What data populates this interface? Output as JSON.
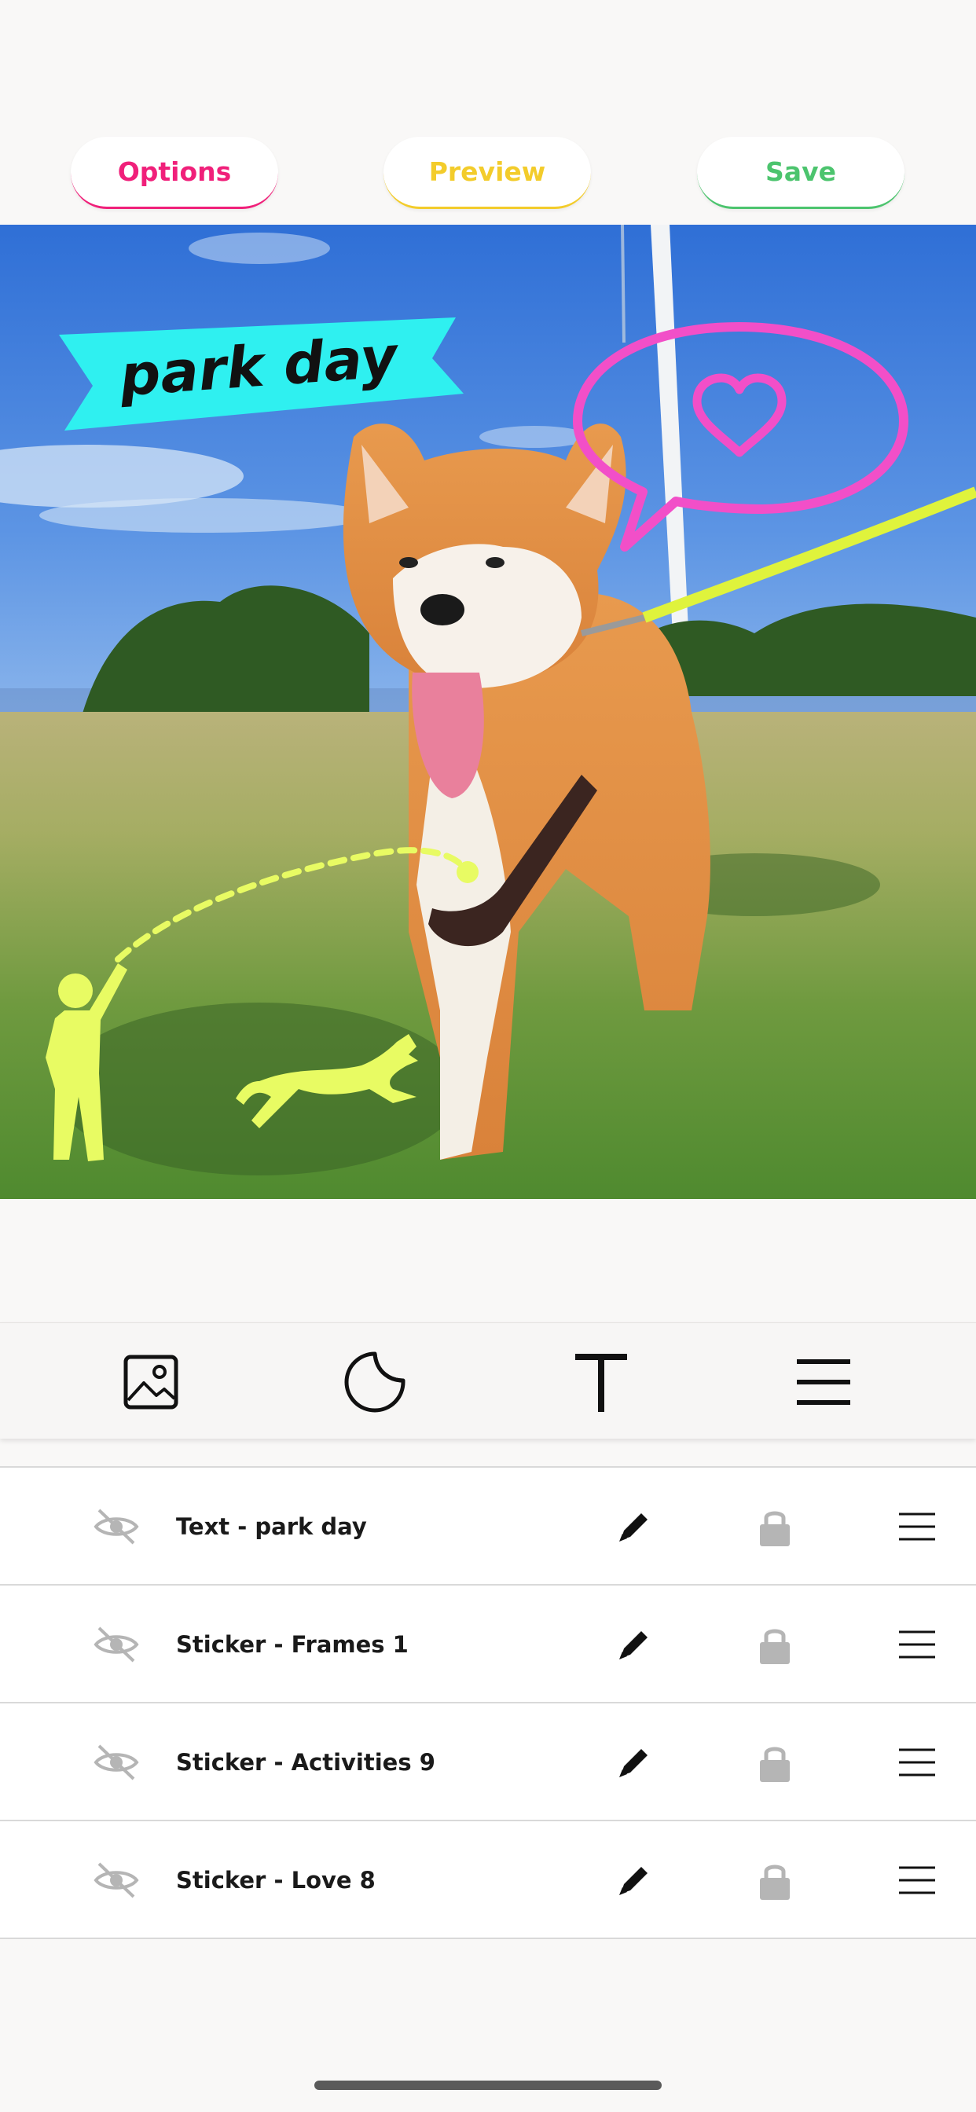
{
  "header": {
    "options_label": "Options",
    "preview_label": "Preview",
    "save_label": "Save",
    "colors": {
      "options": "#f0207a",
      "preview": "#f3cc2b",
      "save": "#4cc46e"
    }
  },
  "canvas": {
    "text_sticker": "park day",
    "stickers": [
      "banner",
      "speech-bubble-heart",
      "person-throwing",
      "running-dog",
      "dashed-arc"
    ],
    "sticker_colors": {
      "banner": "#2ff0f0",
      "bubble": "#f24fc8",
      "lime": "#e8fb63"
    }
  },
  "toolbar": {
    "items": [
      {
        "icon": "image-icon"
      },
      {
        "icon": "sticker-icon"
      },
      {
        "icon": "text-icon"
      },
      {
        "icon": "layers-menu-icon"
      }
    ]
  },
  "layers": {
    "items": [
      {
        "label": "Text - park day"
      },
      {
        "label": "Sticker - Frames 1"
      },
      {
        "label": "Sticker - Activities 9"
      },
      {
        "label": "Sticker - Love 8"
      }
    ]
  }
}
